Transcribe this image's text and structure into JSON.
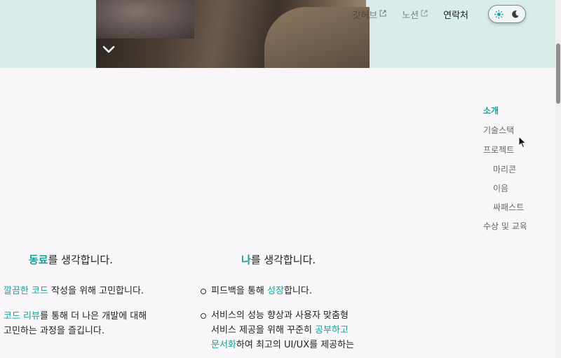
{
  "nav": {
    "items": [
      {
        "label": "깃허브",
        "external": true,
        "faded": true
      },
      {
        "label": "노션",
        "external": true,
        "faded": true
      },
      {
        "label": "연락처",
        "external": false,
        "faded": false
      }
    ],
    "theme_icons": [
      "sun-icon",
      "moon-icon"
    ]
  },
  "toc": {
    "items": [
      {
        "label": "소개",
        "active": true,
        "sub": false
      },
      {
        "label": "기술스택",
        "active": false,
        "sub": false
      },
      {
        "label": "프로젝트",
        "active": false,
        "sub": false
      },
      {
        "label": "마리콘",
        "active": false,
        "sub": true
      },
      {
        "label": "이음",
        "active": false,
        "sub": true
      },
      {
        "label": "싸패스트",
        "active": false,
        "sub": true
      },
      {
        "label": "수상 및 교육",
        "active": false,
        "sub": false
      }
    ]
  },
  "colleague": {
    "title_highlight": "동료",
    "title_rest": "를 생각합니다.",
    "p1_highlight": "깔끔한 코드",
    "p1_rest": " 작성을 위해 고민합니다.",
    "p2_highlight": "코드 리뷰",
    "p2_rest_line1": "를 통해 더 나은 개발에 대해",
    "p2_line2": "고민하는 과정을 즐깁니다."
  },
  "me": {
    "title_highlight": "나",
    "title_rest": "를 생각합니다.",
    "b1_pre": "피드백을 통해 ",
    "b1_highlight": "성장",
    "b1_post": "합니다.",
    "b2_line1": "서비스의 성능 향상과 사용자 맞춤형",
    "b2_line2_pre": "서비스 제공을 위해 꾸준히 ",
    "b2_line2_highlight": "공부하고",
    "b2_line3_highlight": "문서화",
    "b2_line3_post": "하여 최고의 UI/UX를 제공하는"
  },
  "colors": {
    "accent": "#16a19a",
    "header_bg": "#d8ecea",
    "page_bg": "#f8f6f8"
  }
}
